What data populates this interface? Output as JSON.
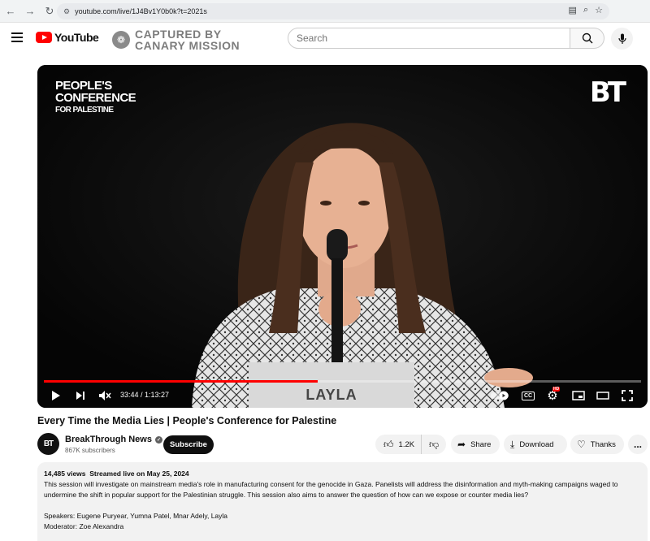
{
  "browser": {
    "url": "youtube.com/live/1J4Bv1Y0b0k?t=2021s",
    "back_icon": "arrow-left-icon",
    "forward_icon": "arrow-right-icon",
    "reload_icon": "reload-icon"
  },
  "header": {
    "logo_text": "YouTube",
    "watermark_line1": "CAPTURED BY",
    "watermark_line2": "CANARY MISSION",
    "search_placeholder": "Search"
  },
  "video": {
    "overlay_title_line1": "PEOPLE'S",
    "overlay_title_line2": "CONFERENCE",
    "overlay_title_line3": "FOR PALESTINE",
    "corner_logo": "BT",
    "nameplate": "LAYLA",
    "current_time": "33:44",
    "duration": "1:13:27",
    "time_display": "33:44 / 1:13:27",
    "progress_fraction": 0.459,
    "buffer_fraction": 0.459,
    "cc_label": "CC",
    "hd_badge": "HD"
  },
  "info": {
    "title": "Every Time the Media Lies | People's Conference for Palestine",
    "channel_name": "BreakThrough News",
    "channel_avatar": "BT",
    "subscribers": "867K subscribers",
    "subscribe_label": "Subscribe",
    "likes": "1.2K",
    "share_label": "Share",
    "download_label": "Download",
    "thanks_label": "Thanks",
    "more_label": "..."
  },
  "description": {
    "views": "14,485 views",
    "streamed": "Streamed live on May 25, 2024",
    "body": "This session will investigate on mainstream media's role in manufacturing consent for the genocide in Gaza. Panelists will address the disinformation and myth-making campaigns waged to undermine the shift in popular support for the Palestinian struggle. This session also aims to answer the question of how can we expose or counter media lies?",
    "speakers": "Speakers: Eugene Puryear, Yumna Patel, Mnar Adely, Layla",
    "moderator": "Moderator: Zoe Alexandra"
  },
  "colors": {
    "accent_red": "#ff0000",
    "video_bg": "#0b0b0b",
    "pill_bg": "#f2f2f2"
  }
}
